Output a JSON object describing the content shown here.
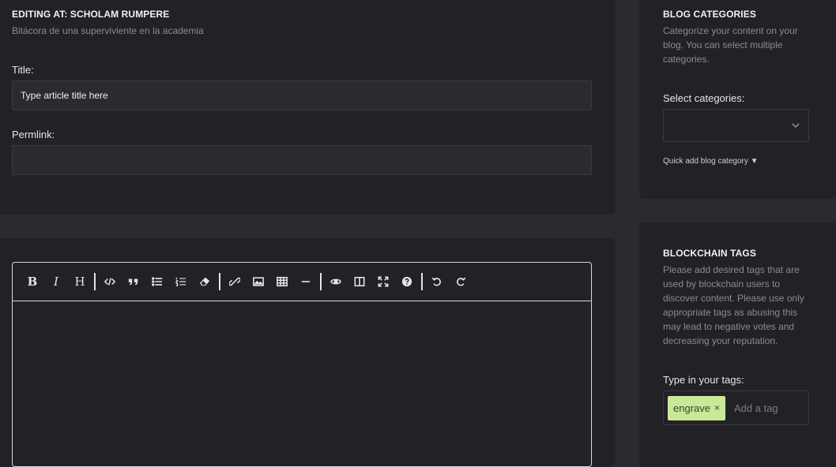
{
  "editing": {
    "heading": "EDITING AT: SCHOLAM RUMPERE",
    "subtitle": "Bitácora de una superviviente en la academia",
    "title_label": "Title:",
    "title_placeholder": "Type article title here",
    "permlink_label": "Permlink:",
    "permlink_value": ""
  },
  "toolbar": {
    "buttons": [
      {
        "name": "bold",
        "icon": "bold-icon",
        "glyph": "B"
      },
      {
        "name": "italic",
        "icon": "italic-icon",
        "glyph": "I"
      },
      {
        "name": "heading",
        "icon": "heading-icon",
        "glyph": "H"
      },
      {
        "name": "code",
        "icon": "code-icon"
      },
      {
        "name": "quote",
        "icon": "quote-icon"
      },
      {
        "name": "unordered-list",
        "icon": "unordered-list-icon"
      },
      {
        "name": "ordered-list",
        "icon": "ordered-list-icon"
      },
      {
        "name": "clean",
        "icon": "eraser-icon"
      },
      {
        "name": "link",
        "icon": "link-icon"
      },
      {
        "name": "image",
        "icon": "image-icon"
      },
      {
        "name": "table",
        "icon": "table-icon"
      },
      {
        "name": "horizontal-rule",
        "icon": "minus-icon"
      },
      {
        "name": "preview",
        "icon": "eye-icon"
      },
      {
        "name": "side-by-side",
        "icon": "columns-icon"
      },
      {
        "name": "fullscreen",
        "icon": "fullscreen-icon"
      },
      {
        "name": "guide",
        "icon": "question-icon"
      },
      {
        "name": "undo",
        "icon": "undo-icon"
      },
      {
        "name": "redo",
        "icon": "redo-icon"
      }
    ]
  },
  "categories": {
    "heading": "BLOG CATEGORIES",
    "description": "Categorize your content on your blog. You can select multiple categories.",
    "select_label": "Select categories:",
    "quick_add": "Quick add blog category ▼"
  },
  "tags": {
    "heading": "BLOCKCHAIN TAGS",
    "description": "Please add desired tags that are used by blockchain users to discover content. Please use only appropriate tags as abusing this may lead to negative votes and decreasing your reputation.",
    "input_label": "Type in your tags:",
    "items": [
      {
        "label": "engrave",
        "remove": "×"
      }
    ],
    "placeholder": "Add a tag"
  },
  "colors": {
    "page_bg": "#2a2b30",
    "card_bg": "#222226",
    "tag_bg": "#c9e89a",
    "tag_text": "#2d4c1c"
  }
}
